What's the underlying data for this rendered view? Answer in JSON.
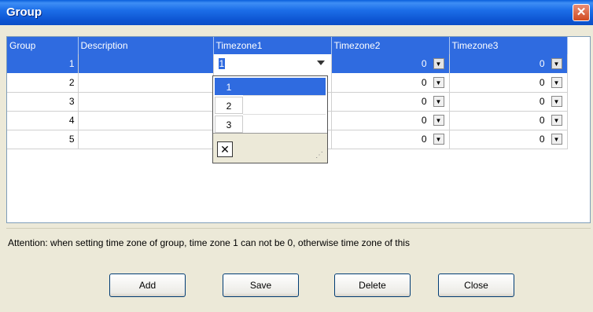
{
  "window": {
    "title": "Group",
    "close_glyph": "✕"
  },
  "grid": {
    "columns": [
      "Group",
      "Description",
      "Timezone1",
      "Timezone2",
      "Timezone3"
    ],
    "rows": [
      {
        "group": "1",
        "description": "",
        "tz1": "1",
        "tz2": "0",
        "tz3": "0"
      },
      {
        "group": "2",
        "description": "",
        "tz1": "",
        "tz2": "0",
        "tz3": "0"
      },
      {
        "group": "3",
        "description": "",
        "tz1": "",
        "tz2": "0",
        "tz3": "0"
      },
      {
        "group": "4",
        "description": "",
        "tz1": "",
        "tz2": "0",
        "tz3": "0"
      },
      {
        "group": "5",
        "description": "",
        "tz1": "",
        "tz2": "0",
        "tz3": "0"
      }
    ],
    "selected_row": 1
  },
  "dropdown": {
    "options": [
      "1",
      "2",
      "3"
    ],
    "selected": "1",
    "clear_glyph": "✕",
    "grip_glyph": "⋰"
  },
  "attention_text": "Attention: when setting time zone of group, time zone 1 can not be 0, otherwise time zone of this",
  "buttons": {
    "add": "Add",
    "save": "Save",
    "delete": "Delete",
    "close": "Close"
  },
  "icons": {
    "close": "close-icon",
    "dropdown_arrow": "chevron-down-icon",
    "clear": "clear-icon",
    "resize": "resize-grip-icon"
  },
  "colors": {
    "titlebar": "#0D55D2",
    "selection": "#2F6BE0",
    "window_bg": "#ECE9D8"
  }
}
